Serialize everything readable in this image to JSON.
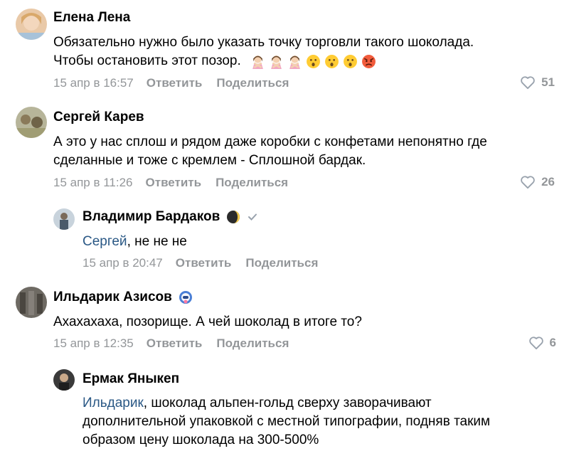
{
  "comments": [
    {
      "author": "Елена Лена",
      "lines": [
        "Обязательно нужно было указать точку торговли такого шоколада.",
        "Чтобы остановить этот позор."
      ],
      "date": "15 апр в 16:57",
      "reply": "Ответить",
      "share": "Поделиться",
      "likes": "51",
      "emojis": [
        "woman-gesturing-no",
        "woman-gesturing-no",
        "woman-gesturing-no",
        "hushed-face",
        "hushed-face",
        "hushed-face",
        "angry-face"
      ]
    },
    {
      "author": "Сергей Карев",
      "lines": [
        "А это у нас сплош и рядом даже коробки с конфетами непонятно где",
        "сделанные и тоже с кремлем - Сплошной бардак."
      ],
      "date": "15 апр в 11:26",
      "reply": "Ответить",
      "share": "Поделиться",
      "likes": "26"
    },
    {
      "author": "Владимир Бардаков",
      "mention": "Сергей",
      "text_rest": ", не не не",
      "date": "15 апр в 20:47",
      "reply": "Ответить",
      "share": "Поделиться",
      "badges": [
        "moon-icon",
        "verified-check-icon"
      ]
    },
    {
      "author": "Ильдарик Азисов",
      "lines": [
        "Ахахахаха, позорище. А чей шоколад в итоге то?"
      ],
      "date": "15 апр в 12:35",
      "reply": "Ответить",
      "share": "Поделиться",
      "likes": "6",
      "badges": [
        "astronaut-badge-icon"
      ]
    },
    {
      "author": "Ермак Яныкеп",
      "mention": "Ильдарик",
      "text_rest": ", шоколад альпен-гольд сверху заворачивают",
      "lines_extra": [
        "дополнительной упаковкой с местной типографии, подняв таким",
        "образом цену шоколада на 300-500%"
      ]
    }
  ]
}
